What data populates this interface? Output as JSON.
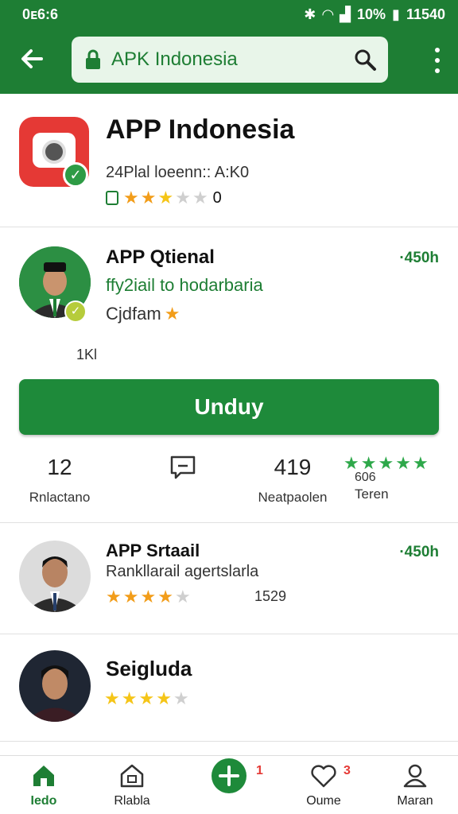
{
  "status_bar": {
    "time_left": "0ᴇ6:6",
    "battery": "10%",
    "time_right": "11540"
  },
  "search": {
    "value": "APK Indonesia"
  },
  "app": {
    "name": "APP Indonesia",
    "subtitle": "24Plal loeenn:: A:K0",
    "rating_count": "0",
    "rating": 3
  },
  "featured": {
    "title": "APP Qtienal",
    "time": "·450h",
    "description": "ffy2iail to hodarbaria",
    "meta": "Cjdfam",
    "small_label": "1Kl",
    "rating": 1
  },
  "download_button": "Unduy",
  "stats": [
    {
      "value": "12",
      "label": "Rnlactano",
      "icon": "home-outline-icon"
    },
    {
      "value": "",
      "label": "",
      "icon": "comment-icon"
    },
    {
      "value": "419",
      "label": "Neatpaolen",
      "icon": ""
    },
    {
      "value": "606",
      "label": "Teren",
      "icon": "five-stars"
    }
  ],
  "list": [
    {
      "title": "APP Srtaail",
      "time": "·450h",
      "description": "Rankllarail agertslarla",
      "meta": "1529",
      "rating": 4
    },
    {
      "title": "Seigluda",
      "time": "",
      "description": "",
      "meta": "",
      "rating": 4
    }
  ],
  "bottom_nav": [
    {
      "label": "Iedo",
      "icon": "home-icon",
      "active": true,
      "badge": ""
    },
    {
      "label": "Rlabla",
      "icon": "store-icon",
      "active": false,
      "badge": ""
    },
    {
      "label": "",
      "icon": "add-icon",
      "active": false,
      "badge": "1"
    },
    {
      "label": "Oume",
      "icon": "heart-icon",
      "active": false,
      "badge": "3"
    },
    {
      "label": "Maran",
      "icon": "person-icon",
      "active": false,
      "badge": ""
    }
  ],
  "colors": {
    "primary": "#1e7e34",
    "accent_red": "#e53935",
    "star_orange": "#f29d1a",
    "star_yellow": "#f5c518"
  }
}
